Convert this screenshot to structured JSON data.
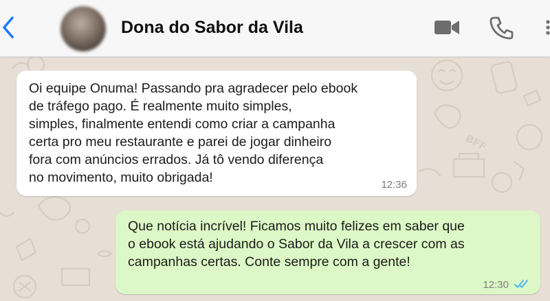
{
  "header": {
    "contact_name": "Dona do Sabor da Vila",
    "back_icon": "chevron-left-icon",
    "video_icon": "video-camera-icon",
    "call_icon": "phone-icon",
    "more_icon": "more-vertical-icon",
    "accent_color": "#1a7cf5"
  },
  "messages": [
    {
      "direction": "incoming",
      "lines": [
        "Oi equipe Onuma! Passando pra agradecer pelo ebook",
        "de tráfego pago. É realmente muito simples,",
        "simples, finalmente entendi como criar a campanha",
        "certa pro meu restaurante e parei de jogar dinheiro",
        "fora com anúncios errados. Já tô vendo diferença",
        "no movimento, muito obrigada!"
      ],
      "time": "12:36"
    },
    {
      "direction": "outgoing",
      "lines": [
        "Que notícia incrível! Ficamos muito felizes em saber que",
        "o ebook está ajudando o Sabor da Vila a crescer com as",
        "campanhas certas. Conte sempre com a gente!"
      ],
      "time": "12:30",
      "status_icon": "double-check-read-icon",
      "status_color": "#4fb6ec"
    }
  ],
  "colors": {
    "header_bg": "#f7f7f7",
    "wallpaper": "#e7dfd6",
    "incoming_bubble": "#ffffff",
    "outgoing_bubble": "#dcf8c6"
  }
}
